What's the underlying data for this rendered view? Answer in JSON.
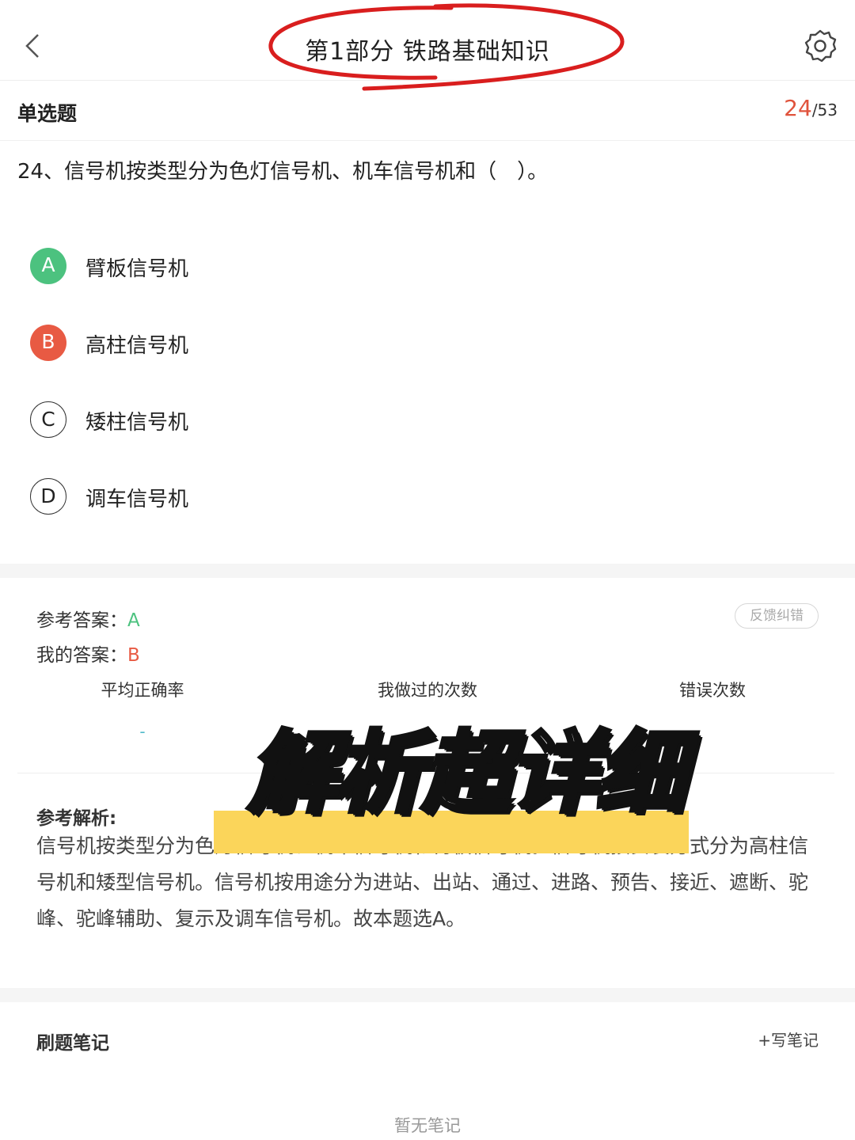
{
  "nav": {
    "title": "第1部分 铁路基础知识",
    "back_icon": "chevron-left-icon",
    "settings_icon": "gear-icon",
    "circle_color": "#d91e1e"
  },
  "header": {
    "question_type": "单选题",
    "current": "24",
    "total": "/53"
  },
  "question": {
    "text": "24、信号机按类型分为色灯信号机、机车信号机和（　）。"
  },
  "options": [
    {
      "letter": "A",
      "text": "臂板信号机",
      "state": "correct"
    },
    {
      "letter": "B",
      "text": "高柱信号机",
      "state": "wrong"
    },
    {
      "letter": "C",
      "text": "矮柱信号机",
      "state": "plain"
    },
    {
      "letter": "D",
      "text": "调车信号机",
      "state": "plain"
    }
  ],
  "answer": {
    "ref_label": "参考答案：",
    "ref_value": "A",
    "mine_label": "我的答案：",
    "mine_value": "B",
    "feedback": "反馈纠错"
  },
  "stats": {
    "labels": [
      "平均正确率",
      "我做过的次数",
      "错误次数"
    ],
    "avg_value": "-"
  },
  "analysis": {
    "title": "参考解析:",
    "text": "信号机按类型分为色灯信号机、机车信号机和臂板信号机。信号机按安装方式分为高柱信号机和矮型信号机。信号机按用途分为进站、出站、通过、进路、预告、接近、遮断、驼峰、驼峰辅助、复示及调车信号机。故本题选A。"
  },
  "overlay": {
    "text": "解析超详细",
    "highlight_color": "#fbd55a"
  },
  "notes": {
    "title": "刷题笔记",
    "write": "+写笔记",
    "empty": "暂无笔记"
  },
  "colors": {
    "correct": "#4cc27f",
    "wrong": "#e85a43",
    "accent": "#e0533c"
  }
}
